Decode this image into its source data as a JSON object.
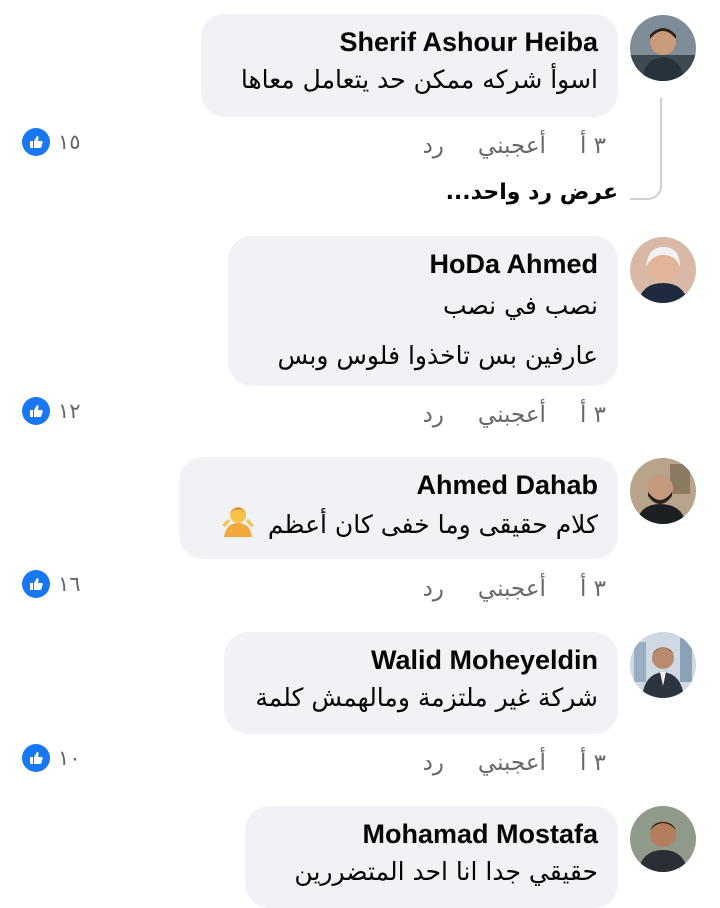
{
  "comments": [
    {
      "author": "Sherif Ashour Heiba",
      "lines": [
        "اسوأ شركه ممكن حد يتعامل معاها"
      ],
      "time": "٣ أ",
      "like_label": "أعجبني",
      "reply_label": "رد",
      "reactions": "١٥"
    },
    {
      "author": "HoDa Ahmed",
      "lines": [
        "نصب في نصب",
        "عارفين بس تاخذوا فلوس وبس"
      ],
      "time": "٣ أ",
      "like_label": "أعجبني",
      "reply_label": "رد",
      "reactions": "١٢"
    },
    {
      "author": "Ahmed Dahab",
      "lines": [
        "كلام حقيقى وما خفى كان أعظم"
      ],
      "emoji": "person-shrugging",
      "time": "٣ أ",
      "like_label": "أعجبني",
      "reply_label": "رد",
      "reactions": "١٦"
    },
    {
      "author": "Walid Moheyeldin",
      "lines": [
        "شركة غير ملتزمة ومالهمش كلمة"
      ],
      "time": "٣ أ",
      "like_label": "أعجبني",
      "reply_label": "رد",
      "reactions": "١٠"
    },
    {
      "author": "Mohamad Mostafa",
      "lines": [
        "حقيقي جدا انا احد المتضررين"
      ]
    }
  ],
  "view_replies": "عرض رد واحد...",
  "colors": {
    "bubble": "#f0f2f5",
    "like_blue": "#1877f2",
    "meta_gray": "#65676b"
  },
  "icons": {
    "reaction": "like-thumbs-up-icon"
  }
}
